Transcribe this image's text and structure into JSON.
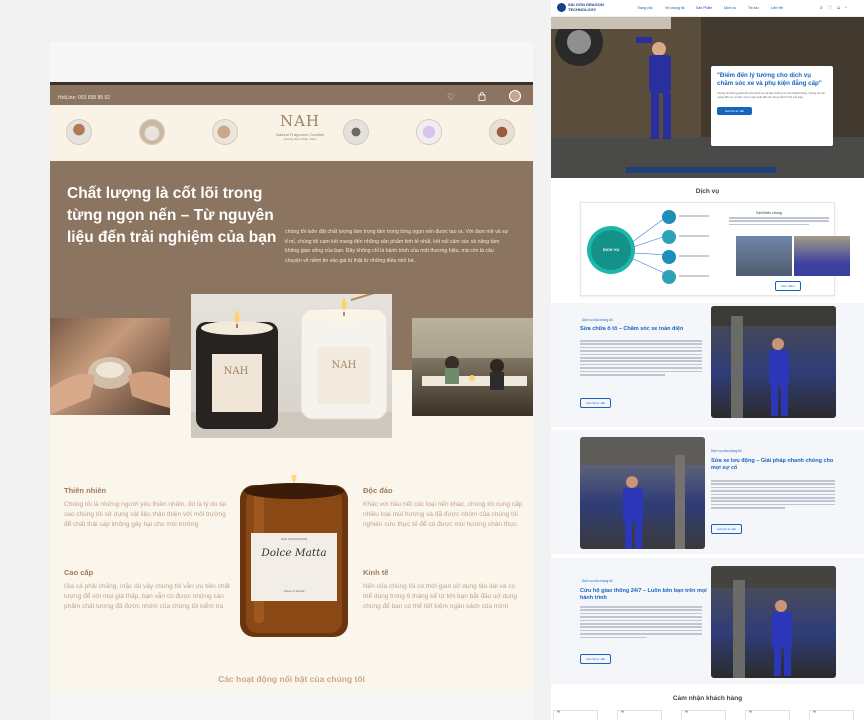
{
  "candle_site": {
    "hotline": "HotLine: 093 658 88 92",
    "brand": {
      "mark": "NAH",
      "name": "Natural Fragrance Candles",
      "slogan": "Hương thơm thiên nhiên"
    },
    "hero": {
      "heading": "Chất lượng là cốt lõi trong từng ngọn nến – Từ nguyên liệu đến trải nghiệm của bạn",
      "paragraph": "chúng tôi luôn đặt chất lượng làm trọng tâm trong từng ngọn nến được tạo ra. Với đam mê và sự tỉ mỉ, chúng tôi cam kết mang đến những sản phẩm tinh tế nhất, kết nối cảm xúc và nâng tầm không gian sống của bạn. Đây không chỉ là hành trình của một thương hiệu, mà còn là câu chuyện về niềm tin vào giá trị thật từ những điều nhỏ bé."
    },
    "candle_label": "NAH",
    "jar_label": {
      "top": "NAH FRAGRANCE",
      "script": "Dolce Matta",
      "bottom": "Notes of Vanilla"
    },
    "features": [
      {
        "title": "Thiên nhiên",
        "text": "Chúng tôi là những người yêu thiên nhiên, đó là lý do tại sao chúng tôi sử dụng vật liệu thân thiện với môi trường để chất thải sáp không gây hại cho môi trường"
      },
      {
        "title": "Độc đáo",
        "text": "Khác với hầu hết các loại nến khác, chúng tôi cung cấp nhiều loại mùi hương và đã được nhóm của chúng tôi nghiên cứu thực tế để có được mùi hương chân thực."
      },
      {
        "title": "Cao cấp",
        "text": "Giá cả phải chăng, mặc dù vậy chúng tôi vẫn ưu tiên chất lượng để với mọi giá thấp, bạn vẫn có được những sản phẩm chất lượng đã được nhóm của chúng tôi kiểm tra"
      },
      {
        "title": "Kinh tế",
        "text": "Nến của chúng tôi có thời gian sử dụng lâu dài và có thể dùng trong 6 tháng kể từ khi bạn bắt đầu sử dụng chúng để bạn có thể tiết kiệm ngân sách của mình"
      }
    ],
    "activities_title": "Các hoạt động nổi bật của chúng tôi",
    "icons": {
      "heart": "heart-icon",
      "bag": "bag-icon"
    }
  },
  "auto_site": {
    "logo_line1": "SÀI GÒN DRAGON",
    "logo_line2": "TECHNOLOGY",
    "nav": [
      "Trang chủ",
      "Về chúng tôi",
      "Sản Phẩm",
      "Dịch vụ",
      "Tin tức",
      "Liên Hệ"
    ],
    "hero": {
      "heading": "\"Điểm đến lý tưởng cho dịch vụ chăm sóc xe và phụ kiện đẳng cấp\"",
      "body": "Chúng tôi không phải chỉ sửa chữa xe và bảo dưỡng xe cho khách hàng, chúng tôi còn mang đến sự an tâm và tin cậy tuyệt đối cho từng hành trình của bạn.",
      "button": "Liên hệ tư vấn"
    },
    "services_title": "Dịch vụ",
    "diagram_center": "DỊCH VỤ",
    "services_box_title": "Giới thiệu chung",
    "services_box_button": "Xem thêm",
    "kicker": "Dịch vụ của chúng tôi",
    "sections": [
      {
        "title": "Sửa chữa ô tô – Chăm sóc xe toàn diện",
        "button": "Liên hệ tư vấn"
      },
      {
        "title": "Sửa xe lưu động – Giải pháp nhanh chóng cho mọi sự cố",
        "button": "Liên hệ tư vấn"
      },
      {
        "title": "Cứu hộ giao thông 24/7 – Luôn bên bạn trên mọi hành trình",
        "button": "Liên hệ tư vấn"
      }
    ],
    "testimonials_title": "Cảm nhận khách hàng",
    "quote_mark": "“",
    "colors": {
      "accent": "#1565c0",
      "brand_navy": "#1b3e8a"
    }
  },
  "colors": {
    "candle_brown": "#8b7560",
    "candle_cream": "#f8f2e7",
    "candle_accent": "#a07b5c"
  }
}
